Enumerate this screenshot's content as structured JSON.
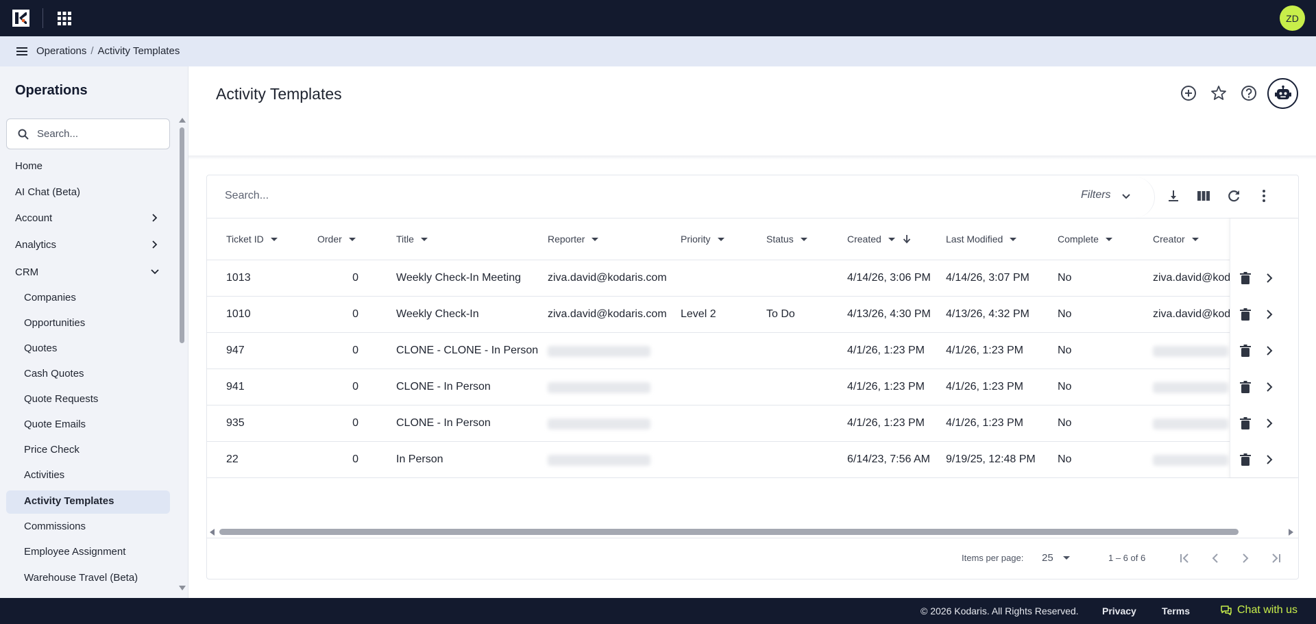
{
  "topbar": {
    "avatar_initials": "ZD",
    "logo_color": "#ffffff",
    "accent": "#c8ee4a"
  },
  "breadcrumb": {
    "root": "Operations",
    "separator": "/",
    "current": "Activity Templates"
  },
  "sidebar": {
    "title": "Operations",
    "search_placeholder": "Search...",
    "items": [
      {
        "label": "Home"
      },
      {
        "label": "AI Chat (Beta)"
      },
      {
        "label": "Account",
        "icon": "chevron-right-icon"
      },
      {
        "label": "Analytics",
        "icon": "chevron-right-icon"
      },
      {
        "label": "CRM",
        "icon": "chevron-down-icon",
        "expanded": true
      }
    ],
    "crm_items": [
      {
        "label": "Companies"
      },
      {
        "label": "Opportunities"
      },
      {
        "label": "Quotes"
      },
      {
        "label": "Cash Quotes"
      },
      {
        "label": "Quote Requests"
      },
      {
        "label": "Quote Emails"
      },
      {
        "label": "Price Check"
      },
      {
        "label": "Activities"
      },
      {
        "label": "Activity Templates",
        "active": true
      },
      {
        "label": "Commissions"
      },
      {
        "label": "Employee Assignment"
      },
      {
        "label": "Warehouse Travel (Beta)"
      }
    ]
  },
  "main": {
    "title": "Activity Templates",
    "header_icons": [
      "add-circle-icon",
      "star-icon",
      "help-icon",
      "robot-icon"
    ]
  },
  "table": {
    "search_placeholder": "Search...",
    "filters_label": "Filters",
    "tool_icons": [
      "download-icon",
      "columns-icon",
      "refresh-icon",
      "more-vert-icon"
    ],
    "columns": [
      "Ticket ID",
      "Order",
      "Title",
      "Reporter",
      "Priority",
      "Status",
      "Created",
      "Last Modified",
      "Complete",
      "Creator"
    ],
    "sorted_column": "Created",
    "sort_direction": "descending",
    "rows": [
      {
        "ticket_id": "1013",
        "order": "0",
        "title": "Weekly Check-In Meeting",
        "reporter": "ziva.david@kodaris.com",
        "priority": "",
        "status": "",
        "created": "4/14/26, 3:06 PM",
        "last_modified": "4/14/26, 3:07 PM",
        "complete": "No",
        "creator": "ziva.david@kodaris.com",
        "reporter_blurred": false
      },
      {
        "ticket_id": "1010",
        "order": "0",
        "title": "Weekly Check-In",
        "reporter": "ziva.david@kodaris.com",
        "priority": "Level 2",
        "status": "To Do",
        "created": "4/13/26, 4:30 PM",
        "last_modified": "4/13/26, 4:32 PM",
        "complete": "No",
        "creator": "ziva.david@kodaris.com",
        "reporter_blurred": false
      },
      {
        "ticket_id": "947",
        "order": "0",
        "title": "CLONE - CLONE - In Person",
        "reporter": "",
        "priority": "",
        "status": "",
        "created": "4/1/26, 1:23 PM",
        "last_modified": "4/1/26, 1:23 PM",
        "complete": "No",
        "creator": "",
        "reporter_blurred": true
      },
      {
        "ticket_id": "941",
        "order": "0",
        "title": "CLONE - In Person",
        "reporter": "",
        "priority": "",
        "status": "",
        "created": "4/1/26, 1:23 PM",
        "last_modified": "4/1/26, 1:23 PM",
        "complete": "No",
        "creator": "",
        "reporter_blurred": true
      },
      {
        "ticket_id": "935",
        "order": "0",
        "title": "CLONE - In Person",
        "reporter": "",
        "priority": "",
        "status": "",
        "created": "4/1/26, 1:23 PM",
        "last_modified": "4/1/26, 1:23 PM",
        "complete": "No",
        "creator": "",
        "reporter_blurred": true
      },
      {
        "ticket_id": "22",
        "order": "0",
        "title": "In Person",
        "reporter": "",
        "priority": "",
        "status": "",
        "created": "6/14/23, 7:56 AM",
        "last_modified": "9/19/25, 12:48 PM",
        "complete": "No",
        "creator": "",
        "reporter_blurred": true
      }
    ],
    "row_icons": [
      "delete-icon",
      "chevron-right-icon"
    ]
  },
  "pagination": {
    "items_per_page_label": "Items per page:",
    "page_size": "25",
    "range": "1 – 6 of 6"
  },
  "footer": {
    "copyright": "© 2026 Kodaris. All Rights Reserved.",
    "privacy": "Privacy",
    "terms": "Terms",
    "chat": "Chat with us"
  }
}
